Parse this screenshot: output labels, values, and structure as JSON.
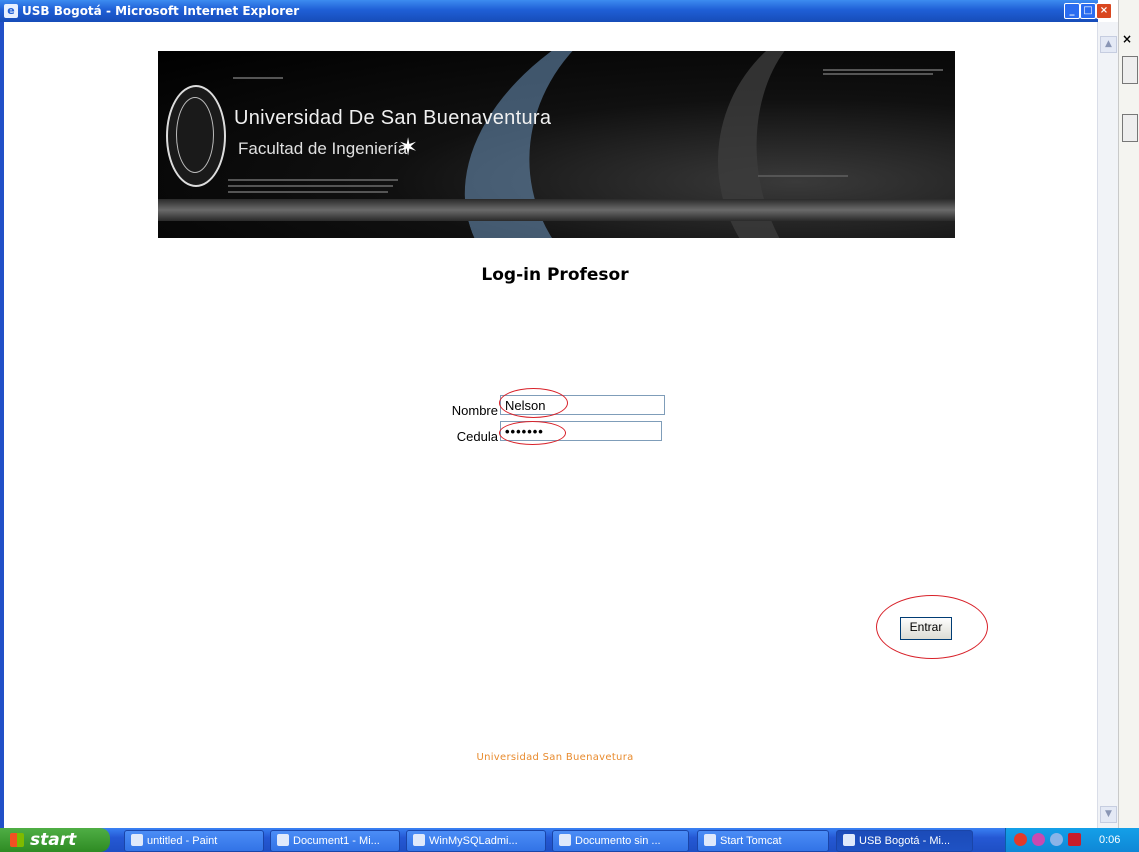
{
  "window": {
    "title": "USB Bogotá - Microsoft Internet Explorer",
    "minimize": "_",
    "maximize": "□",
    "close": "×"
  },
  "banner": {
    "university": "Universidad De San Buenaventura",
    "faculty": "Facultad de Ingeniería"
  },
  "page": {
    "heading": "Log-in Profesor",
    "nombre_label": "Nombre",
    "nombre_value": "Nelson",
    "cedula_label": "Cedula",
    "cedula_value": "•••••••",
    "submit_label": "Entrar",
    "footer": "Universidad San Buenavetura"
  },
  "right_strip": {
    "close": "×"
  },
  "taskbar": {
    "start_label": "start",
    "tasks": [
      {
        "label": "untitled - Paint"
      },
      {
        "label": "Document1 - Mi..."
      },
      {
        "label": "WinMySQLadmi..."
      },
      {
        "label": "Documento sin ..."
      },
      {
        "label": "Start Tomcat"
      },
      {
        "label": "USB Bogotá - Mi..."
      }
    ],
    "clock": "0:06"
  },
  "colors": {
    "annotation_ring": "#d8222a",
    "footer_text": "#e88b2e",
    "title_bar": "#1f5fd6"
  }
}
